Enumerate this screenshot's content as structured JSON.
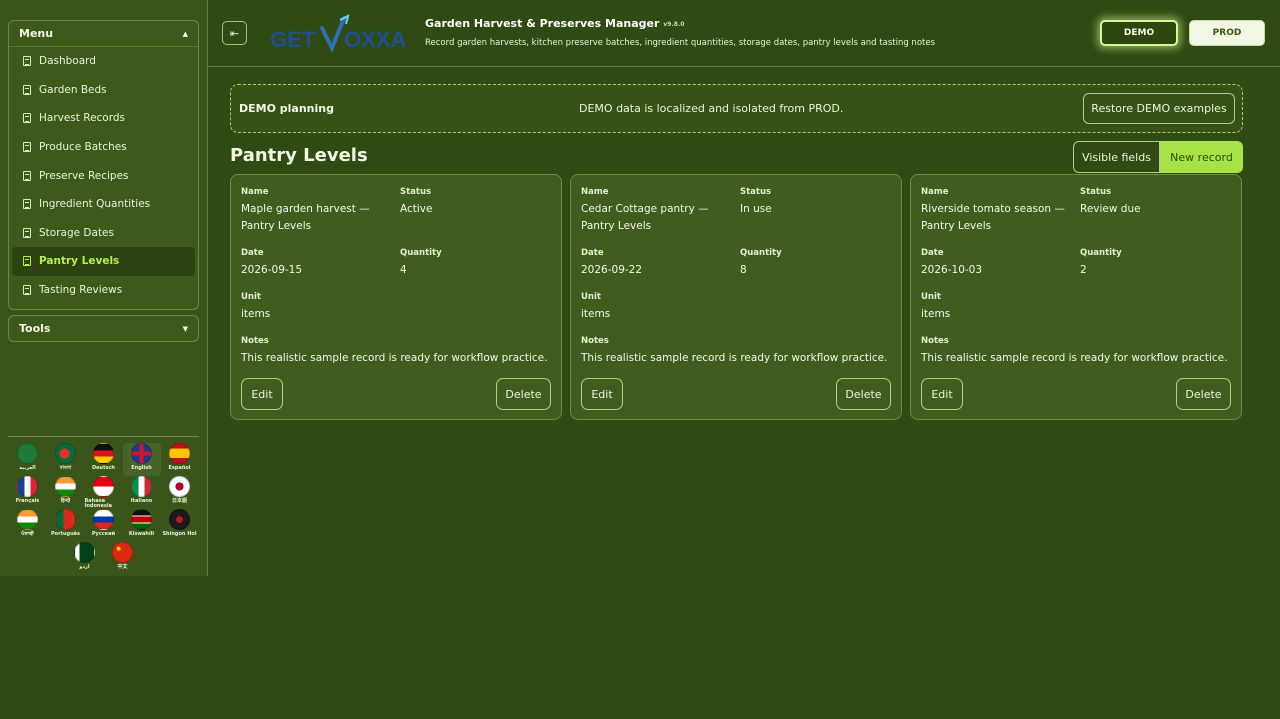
{
  "sidebar": {
    "menu_title": "Menu",
    "items": [
      {
        "label": "Dashboard"
      },
      {
        "label": "Garden Beds"
      },
      {
        "label": "Harvest Records"
      },
      {
        "label": "Produce Batches"
      },
      {
        "label": "Preserve Recipes"
      },
      {
        "label": "Ingredient Quantities"
      },
      {
        "label": "Storage Dates"
      },
      {
        "label": "Pantry Levels",
        "active": true
      },
      {
        "label": "Tasting Reviews"
      }
    ],
    "tools_title": "Tools",
    "languages": [
      {
        "label": "العربية",
        "flag": "sa"
      },
      {
        "label": "বাংলা",
        "flag": "bd"
      },
      {
        "label": "Deutsch",
        "flag": "de"
      },
      {
        "label": "English",
        "flag": "gb",
        "selected": true
      },
      {
        "label": "Español",
        "flag": "es"
      },
      {
        "label": "Français",
        "flag": "fr"
      },
      {
        "label": "हिन्दी",
        "flag": "in"
      },
      {
        "label": "Bahasa Indonesia",
        "flag": "id"
      },
      {
        "label": "Italiano",
        "flag": "it"
      },
      {
        "label": "日本語",
        "flag": "jp"
      },
      {
        "label": "ਪੰਜਾਬੀ",
        "flag": "in"
      },
      {
        "label": "Português",
        "flag": "pt"
      },
      {
        "label": "Русский",
        "flag": "ru"
      },
      {
        "label": "Kiswahili",
        "flag": "ke"
      },
      {
        "label": "Shingon Hol",
        "flag": "sh"
      },
      {
        "label": "اردو",
        "flag": "pk"
      },
      {
        "label": "中文",
        "flag": "cn"
      }
    ]
  },
  "header": {
    "logo_text_1": "GET",
    "logo_text_2": "OXXA",
    "title": "Garden Harvest & Preserves Manager",
    "version": "v9.8.0",
    "subtitle": "Record garden harvests, kitchen preserve batches, ingredient quantities, storage dates, pantry levels and tasting notes",
    "demo_label": "DEMO",
    "prod_label": "PROD"
  },
  "banner": {
    "title": "DEMO planning",
    "message": "DEMO data is localized and isolated from PROD.",
    "restore_label": "Restore DEMO examples"
  },
  "page": {
    "title": "Pantry Levels",
    "visible_fields_label": "Visible fields",
    "new_record_label": "New record"
  },
  "field_labels": {
    "name": "Name",
    "status": "Status",
    "date": "Date",
    "quantity": "Quantity",
    "unit": "Unit",
    "notes": "Notes",
    "edit": "Edit",
    "delete": "Delete"
  },
  "records": [
    {
      "name": "Maple garden harvest — Pantry Levels",
      "status": "Active",
      "date": "2026-09-15",
      "quantity": "4",
      "unit": "items",
      "notes": "This realistic sample record is ready for workflow practice."
    },
    {
      "name": "Cedar Cottage pantry — Pantry Levels",
      "status": "In use",
      "date": "2026-09-22",
      "quantity": "8",
      "unit": "items",
      "notes": "This realistic sample record is ready for workflow practice."
    },
    {
      "name": "Riverside tomato season — Pantry Levels",
      "status": "Review due",
      "date": "2026-10-03",
      "quantity": "2",
      "unit": "items",
      "notes": "This realistic sample record is ready for workflow practice."
    }
  ],
  "colors": {
    "background": "#2f4a12",
    "accent": "#a7e246",
    "active_menu_text": "#b9ef4a"
  }
}
